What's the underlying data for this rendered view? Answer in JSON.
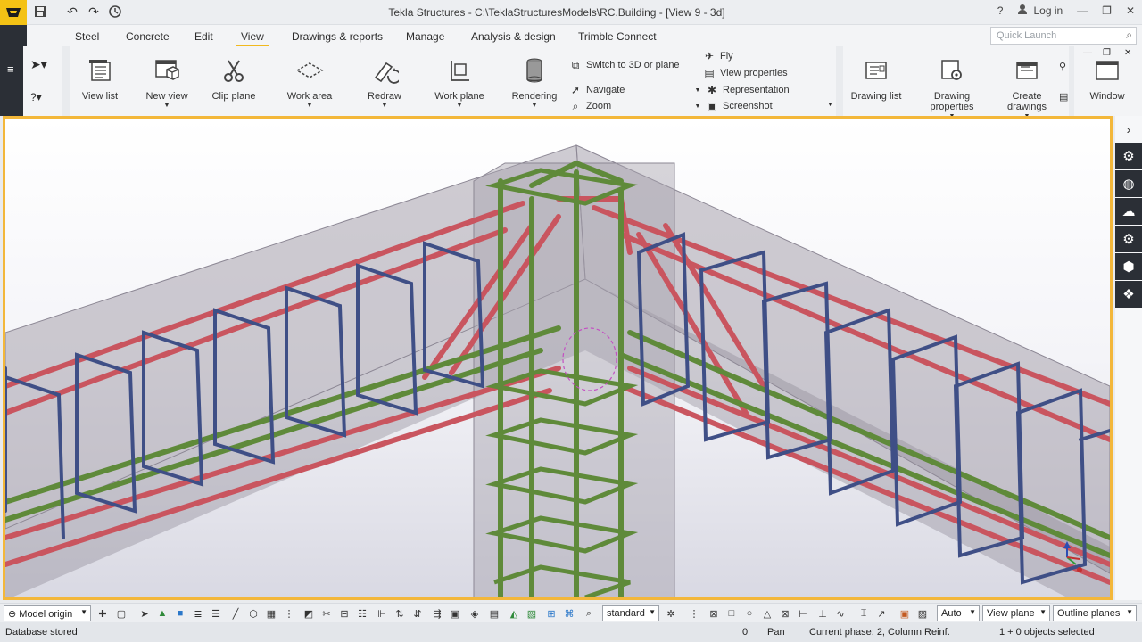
{
  "window": {
    "title": "Tekla Structures - C:\\TeklaStructuresModels\\RC.Building - [View 9 - 3d]",
    "login": "Log in"
  },
  "tabs": [
    {
      "label": "Steel"
    },
    {
      "label": "Concrete"
    },
    {
      "label": "Edit"
    },
    {
      "label": "View"
    },
    {
      "label": "Drawings & reports"
    },
    {
      "label": "Manage"
    },
    {
      "label": "Analysis & design"
    },
    {
      "label": "Trimble Connect"
    }
  ],
  "quick_launch": {
    "placeholder": "Quick Launch"
  },
  "ribbon": {
    "view_list": "View list",
    "new_view": "New view",
    "clip_plane": "Clip plane",
    "work_area": "Work area",
    "redraw": "Redraw",
    "work_plane": "Work plane",
    "rendering": "Rendering",
    "switch_3d": "Switch to 3D or plane",
    "navigate": "Navigate",
    "zoom": "Zoom",
    "fly": "Fly",
    "view_properties": "View properties",
    "representation": "Representation",
    "screenshot": "Screenshot",
    "drawing_list": "Drawing list",
    "drawing_properties": "Drawing properties",
    "create_drawings": "Create drawings",
    "window": "Window"
  },
  "toolbar": {
    "model_origin": "Model origin",
    "standard": "standard",
    "auto": "Auto",
    "view_plane": "View plane",
    "outline_planes": "Outline planes"
  },
  "status": {
    "left": "Database stored",
    "value": "0",
    "mode": "Pan",
    "phase": "Current phase: 2, Column Reinf.",
    "selection": "1 + 0 objects selected"
  },
  "colors": {
    "accent": "#f3b73a",
    "rebar_red": "#c9555f",
    "rebar_blue": "#3f4f86",
    "rebar_green": "#5f8a3a",
    "dark_panel": "#2b2f36"
  }
}
